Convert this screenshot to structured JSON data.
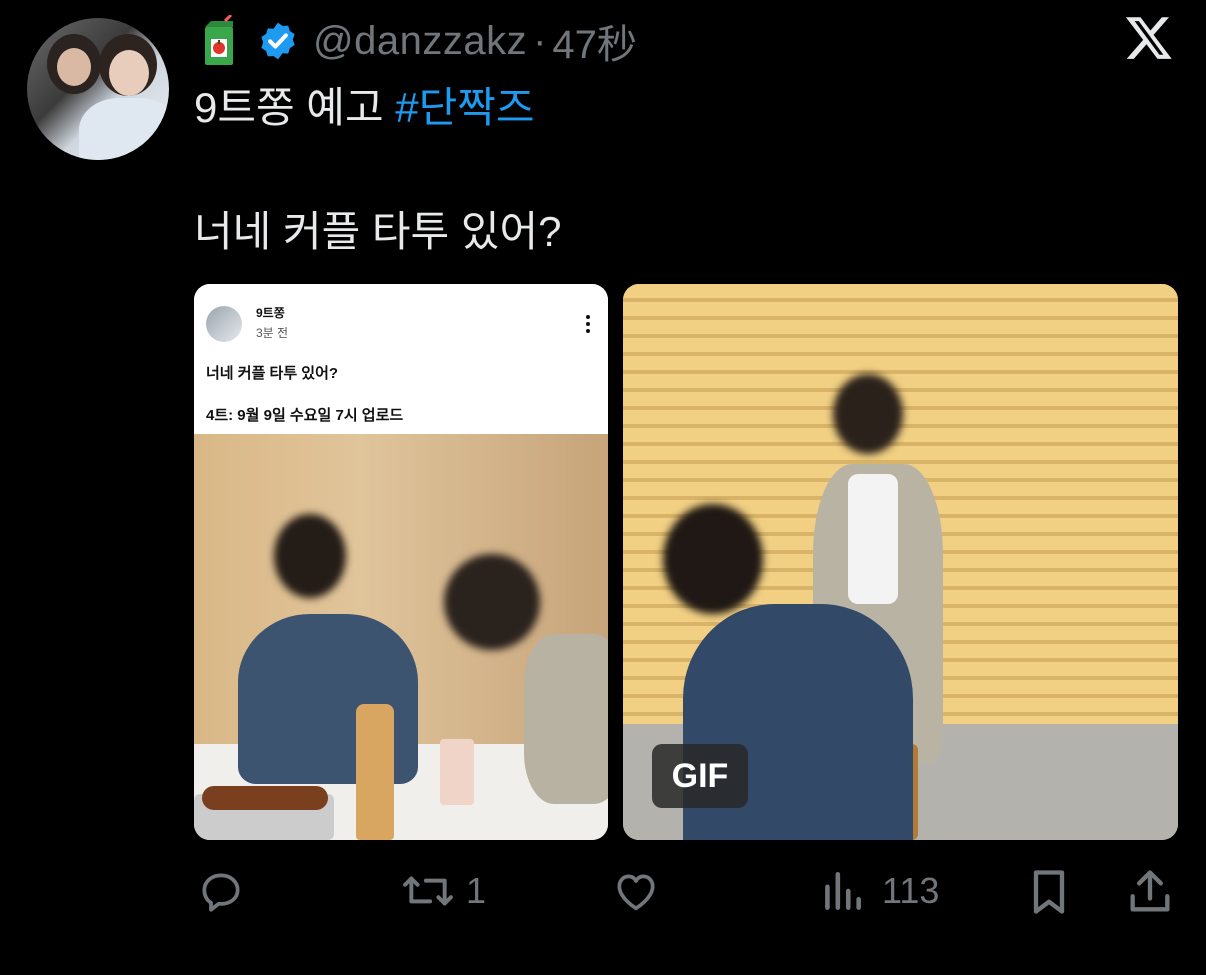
{
  "tweet": {
    "handle": "@danzzakz",
    "separator": "·",
    "timestamp": "47秒",
    "line1_text": "9트쫑 예고 ",
    "hashtag": "#단짝즈",
    "line2_text": "너네 커플 타투 있어?",
    "verified": true
  },
  "embedded_post": {
    "name": "9트쫑",
    "time": "3분 전",
    "text1": "너네 커플 타투 있어?",
    "text2": "4트: 9월 9일 수요일 7시 업로드"
  },
  "media2": {
    "badge": "GIF"
  },
  "actions": {
    "reply_count": "",
    "retweet_count": "1",
    "like_count": "",
    "views_count": "113"
  },
  "icons": {
    "reply": "reply-icon",
    "retweet": "retweet-icon",
    "like": "heart-icon",
    "views": "views-icon",
    "bookmark": "bookmark-icon",
    "share": "share-icon",
    "brand": "x-logo-icon"
  },
  "colors": {
    "background": "#000000",
    "text": "#e7e9ea",
    "muted": "#71767b",
    "link": "#1d9bf0",
    "verified": "#1d9bf0"
  }
}
